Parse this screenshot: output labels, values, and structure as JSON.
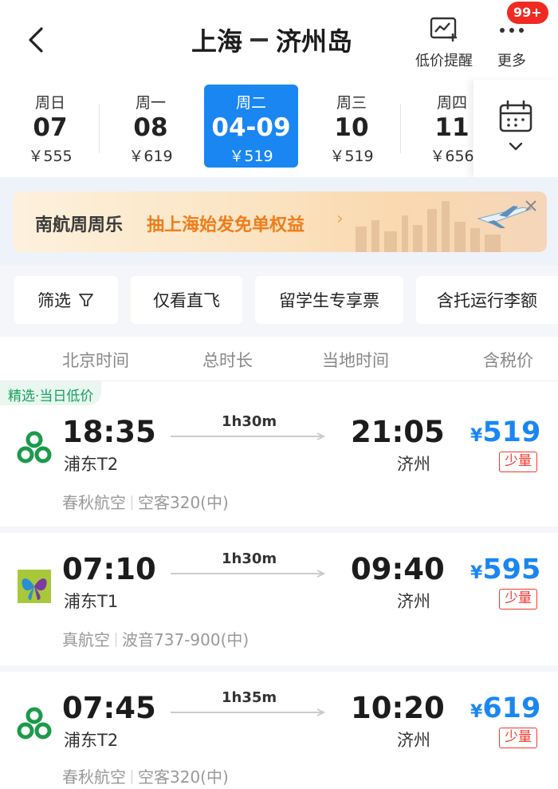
{
  "header": {
    "origin": "上海",
    "destination": "济州岛",
    "alert_label": "低价提醒",
    "more_label": "更多",
    "badge": "99+"
  },
  "dates": [
    {
      "weekday": "周日",
      "day": "07",
      "price": "￥555"
    },
    {
      "weekday": "周一",
      "day": "08",
      "price": "￥619"
    },
    {
      "weekday": "周二",
      "day": "04-09",
      "price": "￥519",
      "selected": true
    },
    {
      "weekday": "周三",
      "day": "10",
      "price": "￥519"
    },
    {
      "weekday": "周四",
      "day": "11",
      "price": "￥656"
    }
  ],
  "banner": {
    "brand": "南航周周乐",
    "promo": "抽上海始发免单权益"
  },
  "filters": [
    "筛选",
    "仅看直飞",
    "留学生专享票",
    "含托运行李额"
  ],
  "columns": [
    "北京时间",
    "总时长",
    "当地时间",
    "含税价"
  ],
  "flights": [
    {
      "tag": "精选·当日低价",
      "logo": "spring-airlines-logo",
      "dep_time": "18:35",
      "duration": "1h30m",
      "arr_time": "21:05",
      "dep_airport": "浦东T2",
      "arr_airport": "济州",
      "currency": "¥",
      "price": "519",
      "availability": "少量",
      "airline": "春秋航空",
      "aircraft": "空客320(中)"
    },
    {
      "tag": "",
      "logo": "juneyao-airlines-logo",
      "dep_time": "07:10",
      "duration": "1h30m",
      "arr_time": "09:40",
      "dep_airport": "浦东T1",
      "arr_airport": "济州",
      "currency": "¥",
      "price": "595",
      "availability": "少量",
      "airline": "真航空",
      "aircraft": "波音737-900(中)"
    },
    {
      "tag": "",
      "logo": "spring-airlines-logo",
      "dep_time": "07:45",
      "duration": "1h35m",
      "arr_time": "10:20",
      "dep_airport": "浦东T2",
      "arr_airport": "济州",
      "currency": "¥",
      "price": "619",
      "availability": "少量",
      "airline": "春秋航空",
      "aircraft": "空客320(中)"
    }
  ],
  "colors": {
    "accent": "#1a86f2",
    "promo": "#ef7d1a",
    "tag_green": "#16a05d",
    "alert_red": "#f03a30"
  }
}
